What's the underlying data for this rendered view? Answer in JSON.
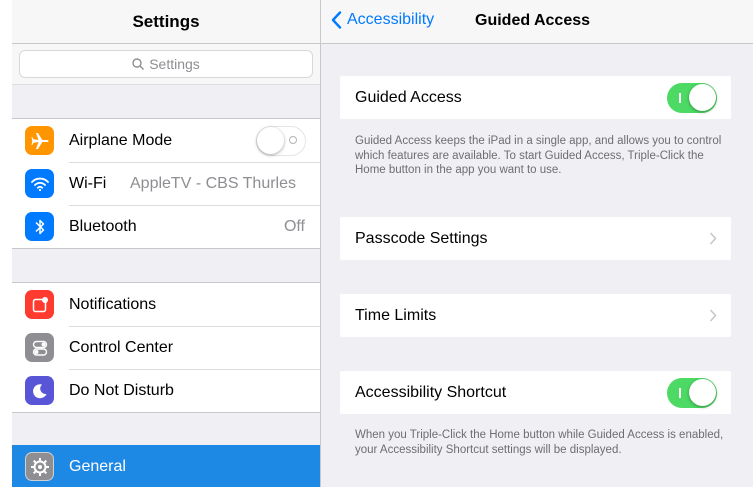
{
  "left_pane": {
    "title": "Settings",
    "search": {
      "placeholder": "Settings"
    },
    "connectivity": [
      {
        "label": "Airplane Mode",
        "icon": "airplane-icon",
        "color": "#ff9500",
        "toggle": "off"
      },
      {
        "label": "Wi-Fi",
        "value": "AppleTV - CBS Thurles",
        "icon": "wifi-icon",
        "color": "#007aff"
      },
      {
        "label": "Bluetooth",
        "value": "Off",
        "icon": "bluetooth-icon",
        "color": "#007aff"
      }
    ],
    "system": [
      {
        "label": "Notifications",
        "icon": "notifications-icon",
        "color": "#ff3b30"
      },
      {
        "label": "Control Center",
        "icon": "control-center-icon",
        "color": "#8e8e93"
      },
      {
        "label": "Do Not Disturb",
        "icon": "moon-icon",
        "color": "#5856d6"
      }
    ],
    "selected": {
      "label": "General",
      "icon": "gear-icon",
      "color": "#8e8e93",
      "highlight": "#1e88e5"
    }
  },
  "right_pane": {
    "back_label": "Accessibility",
    "title": "Guided Access",
    "guided_access": {
      "label": "Guided Access",
      "toggle": "on",
      "footer": "Guided Access keeps the iPad in a single app, and allows you to control which features are available. To start Guided Access, Triple-Click the Home button in the app you want to use."
    },
    "passcode_settings": {
      "label": "Passcode Settings"
    },
    "time_limits": {
      "label": "Time Limits"
    },
    "accessibility_shortcut": {
      "label": "Accessibility Shortcut",
      "toggle": "on",
      "footer": "When you Triple-Click the Home button while Guided Access is enabled, your Accessibility Shortcut settings will be displayed."
    }
  },
  "colors": {
    "accent": "#007aff",
    "toggle_on": "#4cd964",
    "selection": "#1e88e5"
  }
}
